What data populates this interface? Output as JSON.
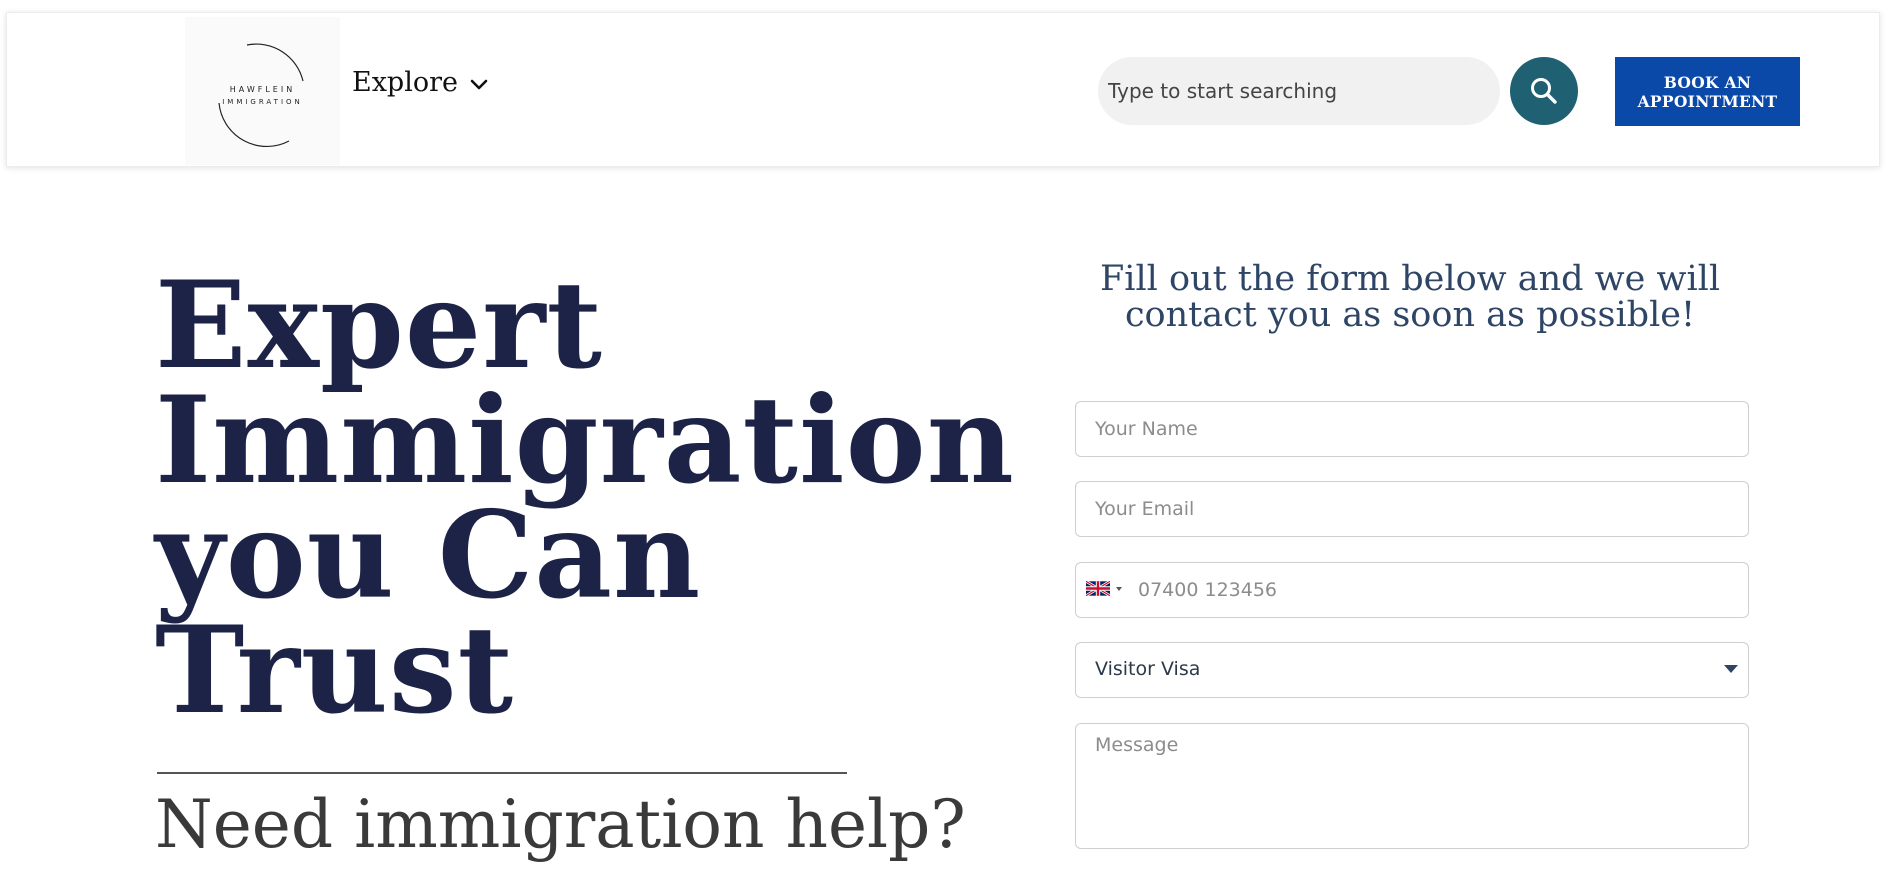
{
  "header": {
    "logo": {
      "line1": "HAWFLEIN",
      "line2": "IMMIGRATION"
    },
    "nav": {
      "explore_label": "Explore"
    },
    "search": {
      "placeholder": "Type to start searching"
    },
    "book_button": {
      "line1": "BOOK AN",
      "line2": "APPOINTMENT"
    }
  },
  "hero": {
    "title_lines": [
      "Expert",
      "Immigration",
      "you Can",
      "Trust"
    ],
    "subtitle": "Need immigration help?"
  },
  "form": {
    "heading": "Fill out the form below and we will contact you as soon as possible!",
    "name_placeholder": "Your Name",
    "email_placeholder": "Your Email",
    "phone_placeholder": "07400 123456",
    "phone_country_icon": "uk-flag-icon",
    "visa_selected": "Visitor Visa",
    "message_placeholder": "Message"
  },
  "colors": {
    "primary_navy": "#1c2347",
    "search_button": "#1f6173",
    "book_button": "#0a49a8",
    "form_heading": "#2e4566"
  }
}
